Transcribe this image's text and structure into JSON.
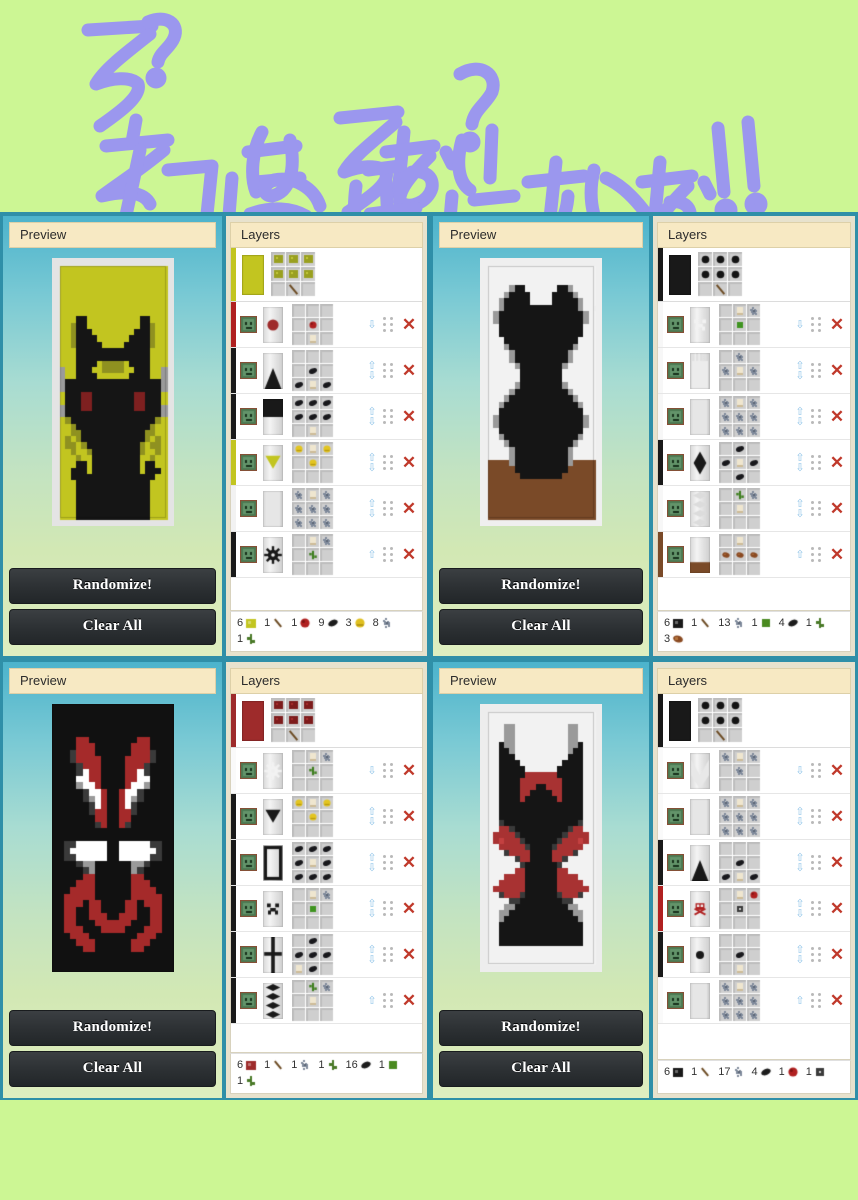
{
  "caption": {
    "line1": "え?",
    "line2": "ネコにみえない?",
    "line3": "気にすんな!!",
    "ink_color": "#9b97ee",
    "background": "#ccf694"
  },
  "ui": {
    "preview_header": "Preview",
    "layers_header": "Layers",
    "randomize_label": "Randomize!",
    "clear_all_label": "Clear All",
    "delete_glyph": "✕",
    "arrow_up_glyph": "⇧",
    "arrow_down_glyph": "⇩"
  },
  "palette": {
    "yellow": "#c2c520",
    "black": "#191919",
    "red": "#9e2b2b",
    "dark_red": "#b02020",
    "gray": "#9a9a9a",
    "light_gray": "#c9c9c9",
    "white": "#f0f0f0",
    "brown": "#7a4a28",
    "green": "#3f7f20",
    "accent_blue": "#2f8fa8",
    "header_cream": "#f7e9c3",
    "panel_beige": "#e7e2cd",
    "button_dark": "#2c3033"
  },
  "apps": [
    {
      "id": "app-1",
      "preview": {
        "base": "yellow",
        "description": "black cat face with yellow background and red eyes"
      },
      "base_layer": {
        "color": "yellow",
        "dye": "#c2c520",
        "recipe": "6 wool + stick"
      },
      "layers": [
        {
          "color": "#9e2b2b",
          "bar": "#b02020",
          "pattern": "circle",
          "can_up": false,
          "can_down": true
        },
        {
          "color": "#191919",
          "bar": "#191919",
          "pattern": "triangle-up",
          "can_up": true,
          "can_down": true
        },
        {
          "color": "#191919",
          "bar": "#191919",
          "pattern": "half-top",
          "can_up": true,
          "can_down": true
        },
        {
          "color": "#c2c520",
          "bar": "#c2c520",
          "pattern": "triangle-down",
          "can_up": true,
          "can_down": true
        },
        {
          "color": "#c9c9c9",
          "bar": "#f2f2f2",
          "pattern": "plain-light",
          "can_up": true,
          "can_down": true
        },
        {
          "color": "#191919",
          "bar": "#191919",
          "pattern": "gear",
          "can_up": true,
          "can_down": false
        }
      ],
      "materials": [
        {
          "count": "6",
          "item": "yellow-wool",
          "color": "#c2c520"
        },
        {
          "count": "1",
          "item": "stick",
          "color": "#9c7b4a"
        },
        {
          "count": "1",
          "item": "rose-red",
          "color": "#b02020"
        },
        {
          "count": "9",
          "item": "ink-sac",
          "color": "#1c1c1c"
        },
        {
          "count": "3",
          "item": "yellow-dye",
          "color": "#e0c020"
        },
        {
          "count": "8",
          "item": "light-gray",
          "color": "#b6bcc6"
        },
        {
          "count": "1",
          "item": "vine",
          "color": "#4a7a28"
        }
      ]
    },
    {
      "id": "app-2",
      "preview": {
        "base": "white",
        "description": "black cat silhouette on white with brown base"
      },
      "base_layer": {
        "color": "black",
        "dye": "#191919",
        "recipe": "6 wool + stick"
      },
      "layers": [
        {
          "color": "#f2f2f2",
          "bar": "#f7f7f7",
          "pattern": "creeper",
          "can_up": false,
          "can_down": true
        },
        {
          "color": "#e8e8e8",
          "bar": "#f7f7f7",
          "pattern": "bordure-ind",
          "can_up": true,
          "can_down": true
        },
        {
          "color": "#e4e4e4",
          "bar": "#f7f7f7",
          "pattern": "plain-light",
          "can_up": true,
          "can_down": true
        },
        {
          "color": "#191919",
          "bar": "#191919",
          "pattern": "lozenge",
          "can_up": true,
          "can_down": true
        },
        {
          "color": "#dcdcdc",
          "bar": "#f7f7f7",
          "pattern": "paly",
          "can_up": true,
          "can_down": true
        },
        {
          "color": "#7a4a28",
          "bar": "#7a4a28",
          "pattern": "base-brown",
          "can_up": true,
          "can_down": false
        }
      ],
      "materials": [
        {
          "count": "6",
          "item": "black-wool",
          "color": "#191919"
        },
        {
          "count": "1",
          "item": "stick",
          "color": "#9c7b4a"
        },
        {
          "count": "13",
          "item": "light-gray",
          "color": "#b6bcc6"
        },
        {
          "count": "1",
          "item": "green-dye",
          "color": "#4a8a20"
        },
        {
          "count": "4",
          "item": "ink-sac",
          "color": "#1c1c1c"
        },
        {
          "count": "1",
          "item": "vine",
          "color": "#4a7a28"
        },
        {
          "count": "3",
          "item": "cocoa",
          "color": "#8a4a22"
        }
      ]
    },
    {
      "id": "app-3",
      "preview": {
        "base": "black",
        "description": "red and white demonic cat face on black"
      },
      "base_layer": {
        "color": "red",
        "dye": "#9e2b2b",
        "recipe": "6 wool + stick"
      },
      "layers": [
        {
          "color": "#f2f2f2",
          "bar": "#fafafa",
          "pattern": "gear",
          "can_up": false,
          "can_down": true
        },
        {
          "color": "#191919",
          "bar": "#191919",
          "pattern": "triangle-down",
          "can_up": true,
          "can_down": true
        },
        {
          "color": "#191919",
          "bar": "#191919",
          "pattern": "bordure",
          "can_up": true,
          "can_down": true
        },
        {
          "color": "#191919",
          "bar": "#191919",
          "pattern": "creeper",
          "can_up": true,
          "can_down": true
        },
        {
          "color": "#191919",
          "bar": "#191919",
          "pattern": "cross",
          "can_up": true,
          "can_down": true
        },
        {
          "color": "#191919",
          "bar": "#191919",
          "pattern": "paly",
          "can_up": true,
          "can_down": false
        }
      ],
      "materials": [
        {
          "count": "6",
          "item": "red-wool",
          "color": "#9e2b2b"
        },
        {
          "count": "1",
          "item": "stick",
          "color": "#9c7b4a"
        },
        {
          "count": "1",
          "item": "light-gray",
          "color": "#b6bcc6"
        },
        {
          "count": "1",
          "item": "vine",
          "color": "#4a7a28"
        },
        {
          "count": "16",
          "item": "ink-sac",
          "color": "#1c1c1c"
        },
        {
          "count": "1",
          "item": "green-dye",
          "color": "#4a8a20"
        },
        {
          "count": "1",
          "item": "vine",
          "color": "#4a7a28"
        }
      ]
    },
    {
      "id": "app-4",
      "preview": {
        "base": "white",
        "description": "black and red horned cat on white"
      },
      "base_layer": {
        "color": "black",
        "dye": "#191919",
        "recipe": "6 wool + stick"
      },
      "layers": [
        {
          "color": "#e8e8e8",
          "bar": "#fafafa",
          "pattern": "chevron-up",
          "can_up": false,
          "can_down": true
        },
        {
          "color": "#e4e4e4",
          "bar": "#fafafa",
          "pattern": "plain-light",
          "can_up": true,
          "can_down": true
        },
        {
          "color": "#191919",
          "bar": "#191919",
          "pattern": "triangle-up",
          "can_up": true,
          "can_down": true
        },
        {
          "color": "#b02020",
          "bar": "#b02020",
          "pattern": "skull",
          "can_up": true,
          "can_down": true
        },
        {
          "color": "#191919",
          "bar": "#191919",
          "pattern": "dot",
          "can_up": true,
          "can_down": true
        },
        {
          "color": "#dcdcdc",
          "bar": "#fafafa",
          "pattern": "plain-light",
          "can_up": true,
          "can_down": false
        }
      ],
      "materials": [
        {
          "count": "6",
          "item": "black-wool",
          "color": "#191919"
        },
        {
          "count": "1",
          "item": "stick",
          "color": "#9c7b4a"
        },
        {
          "count": "17",
          "item": "light-gray",
          "color": "#b6bcc6"
        },
        {
          "count": "4",
          "item": "ink-sac",
          "color": "#1c1c1c"
        },
        {
          "count": "1",
          "item": "rose-red",
          "color": "#b02020"
        },
        {
          "count": "1",
          "item": "gunpowder",
          "color": "#4a4a4a"
        }
      ]
    }
  ]
}
